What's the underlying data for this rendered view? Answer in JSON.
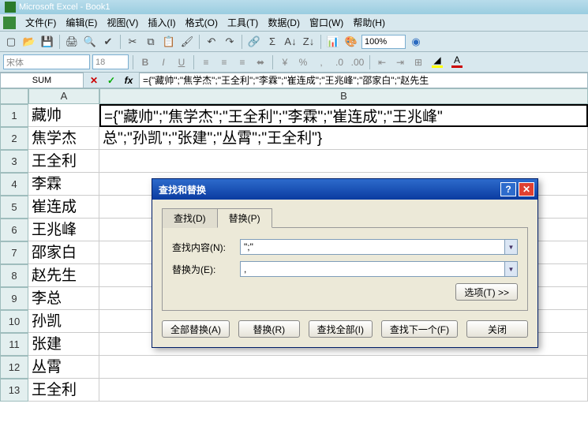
{
  "titlebar": {
    "title": "Microsoft Excel - Book1"
  },
  "menu": {
    "file": "文件(F)",
    "edit": "编辑(E)",
    "view": "视图(V)",
    "insert": "插入(I)",
    "format": "格式(O)",
    "tools": "工具(T)",
    "data": "数据(D)",
    "window": "窗口(W)",
    "help": "帮助(H)"
  },
  "toolbar": {
    "zoom": "100%"
  },
  "format_toolbar": {
    "font": "宋体",
    "size": "18"
  },
  "namebox": "SUM",
  "formula_bar": "={\"藏帅\";\"焦学杰\";\"王全利\";\"李霖\";\"崔连成\";\"王兆峰\";\"邵家白\";\"赵先生",
  "columns": {
    "A": "A",
    "B": "B"
  },
  "rows": [
    {
      "n": "1",
      "A": "藏帅",
      "B": "={\"藏帅\";\"焦学杰\";\"王全利\";\"李霖\";\"崔连成\";\"王兆峰\""
    },
    {
      "n": "2",
      "A": "焦学杰",
      "B": "总\";\"孙凯\";\"张建\";\"丛霄\";\"王全利\"}"
    },
    {
      "n": "3",
      "A": "王全利",
      "B": ""
    },
    {
      "n": "4",
      "A": "李霖",
      "B": ""
    },
    {
      "n": "5",
      "A": "崔连成",
      "B": ""
    },
    {
      "n": "6",
      "A": "王兆峰",
      "B": ""
    },
    {
      "n": "7",
      "A": "邵家白",
      "B": ""
    },
    {
      "n": "8",
      "A": "赵先生",
      "B": ""
    },
    {
      "n": "9",
      "A": "李总",
      "B": ""
    },
    {
      "n": "10",
      "A": "孙凯",
      "B": ""
    },
    {
      "n": "11",
      "A": "张建",
      "B": ""
    },
    {
      "n": "12",
      "A": "丛霄",
      "B": ""
    },
    {
      "n": "13",
      "A": "王全利",
      "B": ""
    }
  ],
  "dialog": {
    "title": "查找和替换",
    "tabs": {
      "find": "查找(D)",
      "replace": "替换(P)"
    },
    "find_label": "查找内容(N):",
    "find_value": "\";\"",
    "replace_label": "替换为(E):",
    "replace_value": ",",
    "options_btn": "选项(T) >>",
    "buttons": {
      "replace_all": "全部替换(A)",
      "replace": "替换(R)",
      "find_all": "查找全部(I)",
      "find_next": "查找下一个(F)",
      "close": "关闭"
    }
  }
}
